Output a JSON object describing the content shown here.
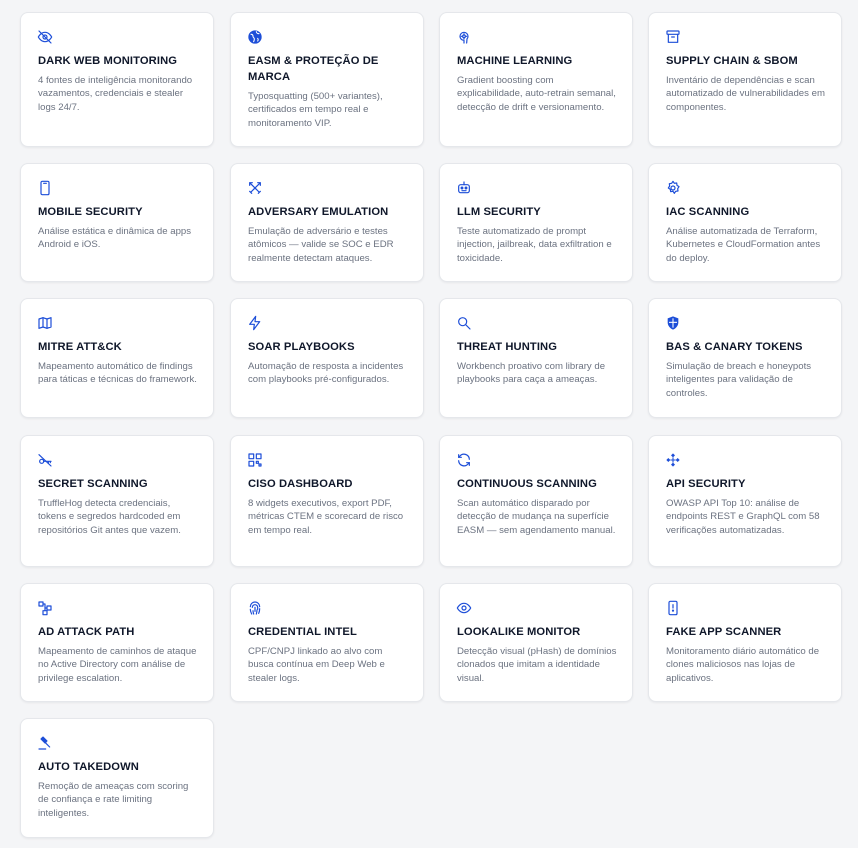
{
  "accent": "#1d4ed8",
  "cards": [
    {
      "icon": "eye-off-icon",
      "title": "DARK WEB MONITORING",
      "desc": "4 fontes de inteligência monitorando vazamentos, credenciais e stealer logs 24/7."
    },
    {
      "icon": "globe-icon",
      "title": "EASM & PROTEÇÃO DE MARCA",
      "desc": "Typosquatting (500+ variantes), certificados em tempo real e monitoramento VIP."
    },
    {
      "icon": "brain-icon",
      "title": "MACHINE LEARNING",
      "desc": "Gradient boosting com explicabilidade, auto-retrain semanal, detecção de drift e versionamento."
    },
    {
      "icon": "archive-box-icon",
      "title": "SUPPLY CHAIN & SBOM",
      "desc": "Inventário de dependências e scan automatizado de vulnerabilidades em componentes."
    },
    {
      "icon": "smartphone-icon",
      "title": "MOBILE SECURITY",
      "desc": "Análise estática e dinâmica de apps Android e iOS."
    },
    {
      "icon": "swords-icon",
      "title": "ADVERSARY EMULATION",
      "desc": "Emulação de adversário e testes atômicos — valide se SOC e EDR realmente detectam ataques."
    },
    {
      "icon": "robot-icon",
      "title": "LLM SECURITY",
      "desc": "Teste automatizado de prompt injection, jailbreak, data exfiltration e toxicidade."
    },
    {
      "icon": "gear-icon",
      "title": "IAC SCANNING",
      "desc": "Análise automatizada de Terraform, Kubernetes e CloudFormation antes do deploy."
    },
    {
      "icon": "map-icon",
      "title": "MITRE ATT&CK",
      "desc": "Mapeamento automático de findings para táticas e técnicas do framework."
    },
    {
      "icon": "lightning-icon",
      "title": "SOAR PLAYBOOKS",
      "desc": "Automação de resposta a incidentes com playbooks pré-configurados."
    },
    {
      "icon": "search-icon",
      "title": "THREAT HUNTING",
      "desc": "Workbench proativo com library de playbooks para caça a ameaças."
    },
    {
      "icon": "shield-icon",
      "title": "BAS & CANARY TOKENS",
      "desc": "Simulação de breach e honeypots inteligentes para validação de controles."
    },
    {
      "icon": "key-off-icon",
      "title": "SECRET SCANNING",
      "desc": "TruffleHog detecta credenciais, tokens e segredos hardcoded em repositórios Git antes que vazem."
    },
    {
      "icon": "dashboard-icon",
      "title": "CISO DASHBOARD",
      "desc": "8 widgets executivos, export PDF, métricas CTEM e scorecard de risco em tempo real."
    },
    {
      "icon": "refresh-icon",
      "title": "CONTINUOUS SCANNING",
      "desc": "Scan automático disparado por detecção de mudança na superfície EASM — sem agendamento manual."
    },
    {
      "icon": "api-nodes-icon",
      "title": "API SECURITY",
      "desc": "OWASP API Top 10: análise de endpoints REST e GraphQL com 58 verificações automatizadas."
    },
    {
      "icon": "network-path-icon",
      "title": "AD ATTACK PATH",
      "desc": "Mapeamento de caminhos de ataque no Active Directory com análise de privilege escalation."
    },
    {
      "icon": "fingerprint-icon",
      "title": "CREDENTIAL INTEL",
      "desc": "CPF/CNPJ linkado ao alvo com busca contínua em Deep Web e stealer logs."
    },
    {
      "icon": "eye-icon",
      "title": "LOOKALIKE MONITOR",
      "desc": "Detecção visual (pHash) de domínios clonados que imitam a identidade visual."
    },
    {
      "icon": "phone-alert-icon",
      "title": "FAKE APP SCANNER",
      "desc": "Monitoramento diário automático de clones maliciosos nas lojas de aplicativos."
    },
    {
      "icon": "gavel-icon",
      "title": "AUTO TAKEDOWN",
      "desc": "Remoção de ameaças com scoring de confiança e rate limiting inteligentes."
    }
  ]
}
